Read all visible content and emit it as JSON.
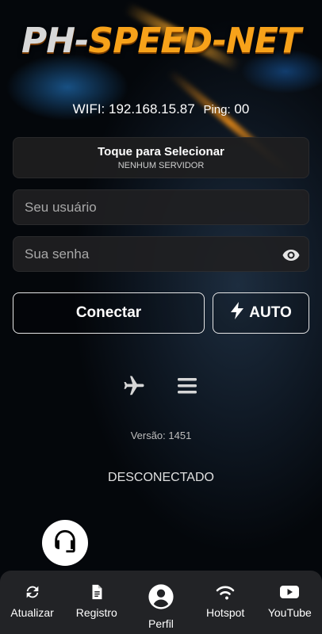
{
  "header": {
    "logo_prefix": "PH-",
    "logo_main": "SPEED-NET",
    "wifi_text": "WIFI: 192.168.15.87",
    "ping_label": "Ping:",
    "ping_value": "00"
  },
  "server": {
    "title": "Toque para Selecionar",
    "subtitle": "NENHUM SERVIDOR"
  },
  "form": {
    "username_placeholder": "Seu usuário",
    "username_value": "",
    "password_placeholder": "Sua senha",
    "password_value": ""
  },
  "actions": {
    "connect_label": "Conectar",
    "auto_label": "AUTO"
  },
  "icons": {
    "airplane": "airplane-icon",
    "menu": "menu-icon",
    "eye": "eye-icon",
    "bolt": "bolt-icon",
    "support": "headset-icon"
  },
  "version_text": "Versão: 1451",
  "connection_status": "DESCONECTADO",
  "nav": {
    "items": [
      {
        "label": "Atualizar",
        "icon": "refresh-icon"
      },
      {
        "label": "Registro",
        "icon": "document-icon"
      },
      {
        "label": "Perfil",
        "icon": "user-icon"
      },
      {
        "label": "Hotspot",
        "icon": "wifi-icon"
      },
      {
        "label": "YouTube",
        "icon": "youtube-icon"
      }
    ]
  },
  "colors": {
    "logo_accent": "#f7a21a",
    "panel_bg": "#1e1e20",
    "nav_bg": "#222326"
  }
}
